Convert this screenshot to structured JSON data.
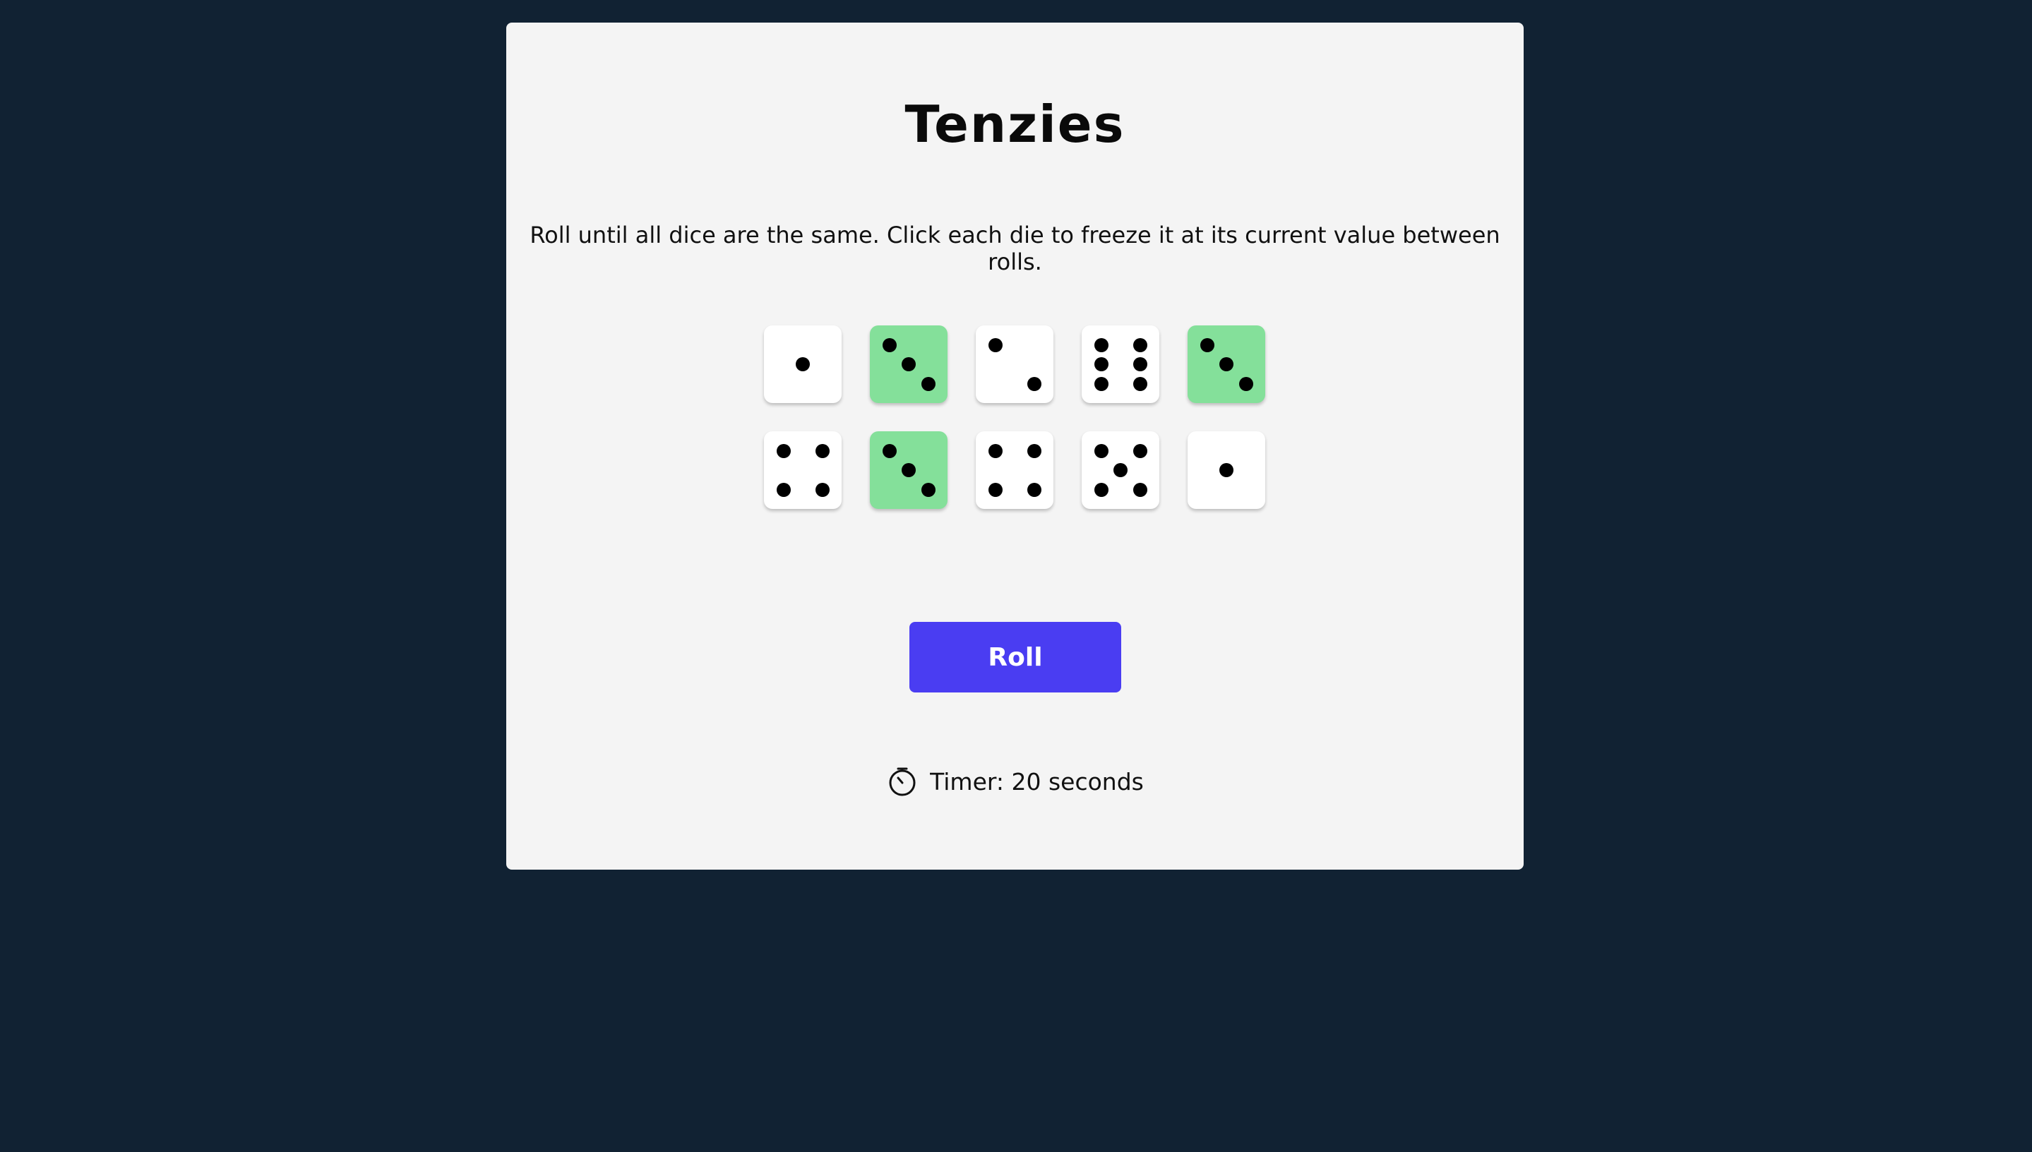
{
  "game": {
    "title": "Tenzies",
    "instructions": "Roll until all dice are the same. Click each die to freeze it at its current value between rolls.",
    "roll_label": "Roll",
    "timer_text": "Timer: 20 seconds",
    "timer_icon": "stopwatch-icon"
  },
  "dice": [
    {
      "value": 1,
      "held": false
    },
    {
      "value": 3,
      "held": true
    },
    {
      "value": 2,
      "held": false
    },
    {
      "value": 6,
      "held": false
    },
    {
      "value": 3,
      "held": true
    },
    {
      "value": 4,
      "held": false
    },
    {
      "value": 3,
      "held": true
    },
    {
      "value": 4,
      "held": false
    },
    {
      "value": 5,
      "held": false
    },
    {
      "value": 1,
      "held": false
    }
  ],
  "colors": {
    "background": "#112233",
    "card": "#f4f4f4",
    "held_die": "#84e09a",
    "die": "#ffffff",
    "roll_button": "#4a3df2"
  }
}
